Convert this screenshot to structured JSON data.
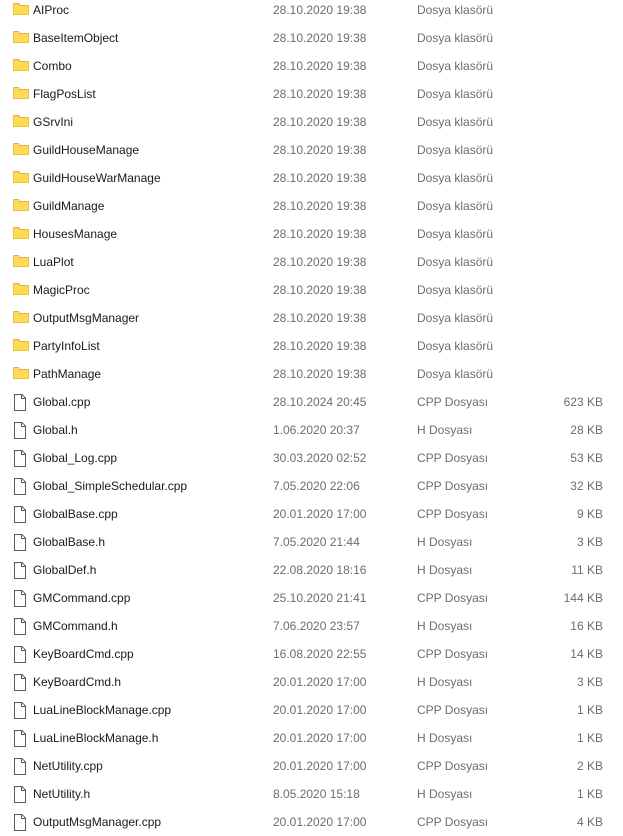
{
  "files": [
    {
      "name": "AIProc",
      "date": "28.10.2020 19:38",
      "type": "Dosya klasörü",
      "size": "",
      "icon": "folder-icon"
    },
    {
      "name": "BaseItemObject",
      "date": "28.10.2020 19:38",
      "type": "Dosya klasörü",
      "size": "",
      "icon": "folder-icon"
    },
    {
      "name": "Combo",
      "date": "28.10.2020 19:38",
      "type": "Dosya klasörü",
      "size": "",
      "icon": "folder-icon"
    },
    {
      "name": "FlagPosList",
      "date": "28.10.2020 19:38",
      "type": "Dosya klasörü",
      "size": "",
      "icon": "folder-icon"
    },
    {
      "name": "GSrvIni",
      "date": "28.10.2020 19:38",
      "type": "Dosya klasörü",
      "size": "",
      "icon": "folder-icon"
    },
    {
      "name": "GuildHouseManage",
      "date": "28.10.2020 19:38",
      "type": "Dosya klasörü",
      "size": "",
      "icon": "folder-icon"
    },
    {
      "name": "GuildHouseWarManage",
      "date": "28.10.2020 19:38",
      "type": "Dosya klasörü",
      "size": "",
      "icon": "folder-icon"
    },
    {
      "name": "GuildManage",
      "date": "28.10.2020 19:38",
      "type": "Dosya klasörü",
      "size": "",
      "icon": "folder-icon"
    },
    {
      "name": "HousesManage",
      "date": "28.10.2020 19:38",
      "type": "Dosya klasörü",
      "size": "",
      "icon": "folder-icon"
    },
    {
      "name": "LuaPlot",
      "date": "28.10.2020 19:38",
      "type": "Dosya klasörü",
      "size": "",
      "icon": "folder-icon"
    },
    {
      "name": "MagicProc",
      "date": "28.10.2020 19:38",
      "type": "Dosya klasörü",
      "size": "",
      "icon": "folder-icon"
    },
    {
      "name": "OutputMsgManager",
      "date": "28.10.2020 19:38",
      "type": "Dosya klasörü",
      "size": "",
      "icon": "folder-icon"
    },
    {
      "name": "PartyInfoList",
      "date": "28.10.2020 19:38",
      "type": "Dosya klasörü",
      "size": "",
      "icon": "folder-icon"
    },
    {
      "name": "PathManage",
      "date": "28.10.2020 19:38",
      "type": "Dosya klasörü",
      "size": "",
      "icon": "folder-icon"
    },
    {
      "name": "Global.cpp",
      "date": "28.10.2024 20:45",
      "type": "CPP Dosyası",
      "size": "623 KB",
      "icon": "file-icon"
    },
    {
      "name": "Global.h",
      "date": "1.06.2020 20:37",
      "type": "H Dosyası",
      "size": "28 KB",
      "icon": "file-icon"
    },
    {
      "name": "Global_Log.cpp",
      "date": "30.03.2020 02:52",
      "type": "CPP Dosyası",
      "size": "53 KB",
      "icon": "file-icon"
    },
    {
      "name": "Global_SimpleSchedular.cpp",
      "date": "7.05.2020 22:06",
      "type": "CPP Dosyası",
      "size": "32 KB",
      "icon": "file-icon"
    },
    {
      "name": "GlobalBase.cpp",
      "date": "20.01.2020 17:00",
      "type": "CPP Dosyası",
      "size": "9 KB",
      "icon": "file-icon"
    },
    {
      "name": "GlobalBase.h",
      "date": "7.05.2020 21:44",
      "type": "H Dosyası",
      "size": "3 KB",
      "icon": "file-icon"
    },
    {
      "name": "GlobalDef.h",
      "date": "22.08.2020 18:16",
      "type": "H Dosyası",
      "size": "11 KB",
      "icon": "file-icon"
    },
    {
      "name": "GMCommand.cpp",
      "date": "25.10.2020 21:41",
      "type": "CPP Dosyası",
      "size": "144 KB",
      "icon": "file-icon"
    },
    {
      "name": "GMCommand.h",
      "date": "7.06.2020 23:57",
      "type": "H Dosyası",
      "size": "16 KB",
      "icon": "file-icon"
    },
    {
      "name": "KeyBoardCmd.cpp",
      "date": "16.08.2020 22:55",
      "type": "CPP Dosyası",
      "size": "14 KB",
      "icon": "file-icon"
    },
    {
      "name": "KeyBoardCmd.h",
      "date": "20.01.2020 17:00",
      "type": "H Dosyası",
      "size": "3 KB",
      "icon": "file-icon"
    },
    {
      "name": "LuaLineBlockManage.cpp",
      "date": "20.01.2020 17:00",
      "type": "CPP Dosyası",
      "size": "1 KB",
      "icon": "file-icon"
    },
    {
      "name": "LuaLineBlockManage.h",
      "date": "20.01.2020 17:00",
      "type": "H Dosyası",
      "size": "1 KB",
      "icon": "file-icon"
    },
    {
      "name": "NetUtility.cpp",
      "date": "20.01.2020 17:00",
      "type": "CPP Dosyası",
      "size": "2 KB",
      "icon": "file-icon"
    },
    {
      "name": "NetUtility.h",
      "date": "8.05.2020 15:18",
      "type": "H Dosyası",
      "size": "1 KB",
      "icon": "file-icon"
    },
    {
      "name": "OutputMsgManager.cpp",
      "date": "20.01.2020 17:00",
      "type": "CPP Dosyası",
      "size": "4 KB",
      "icon": "file-icon"
    }
  ]
}
